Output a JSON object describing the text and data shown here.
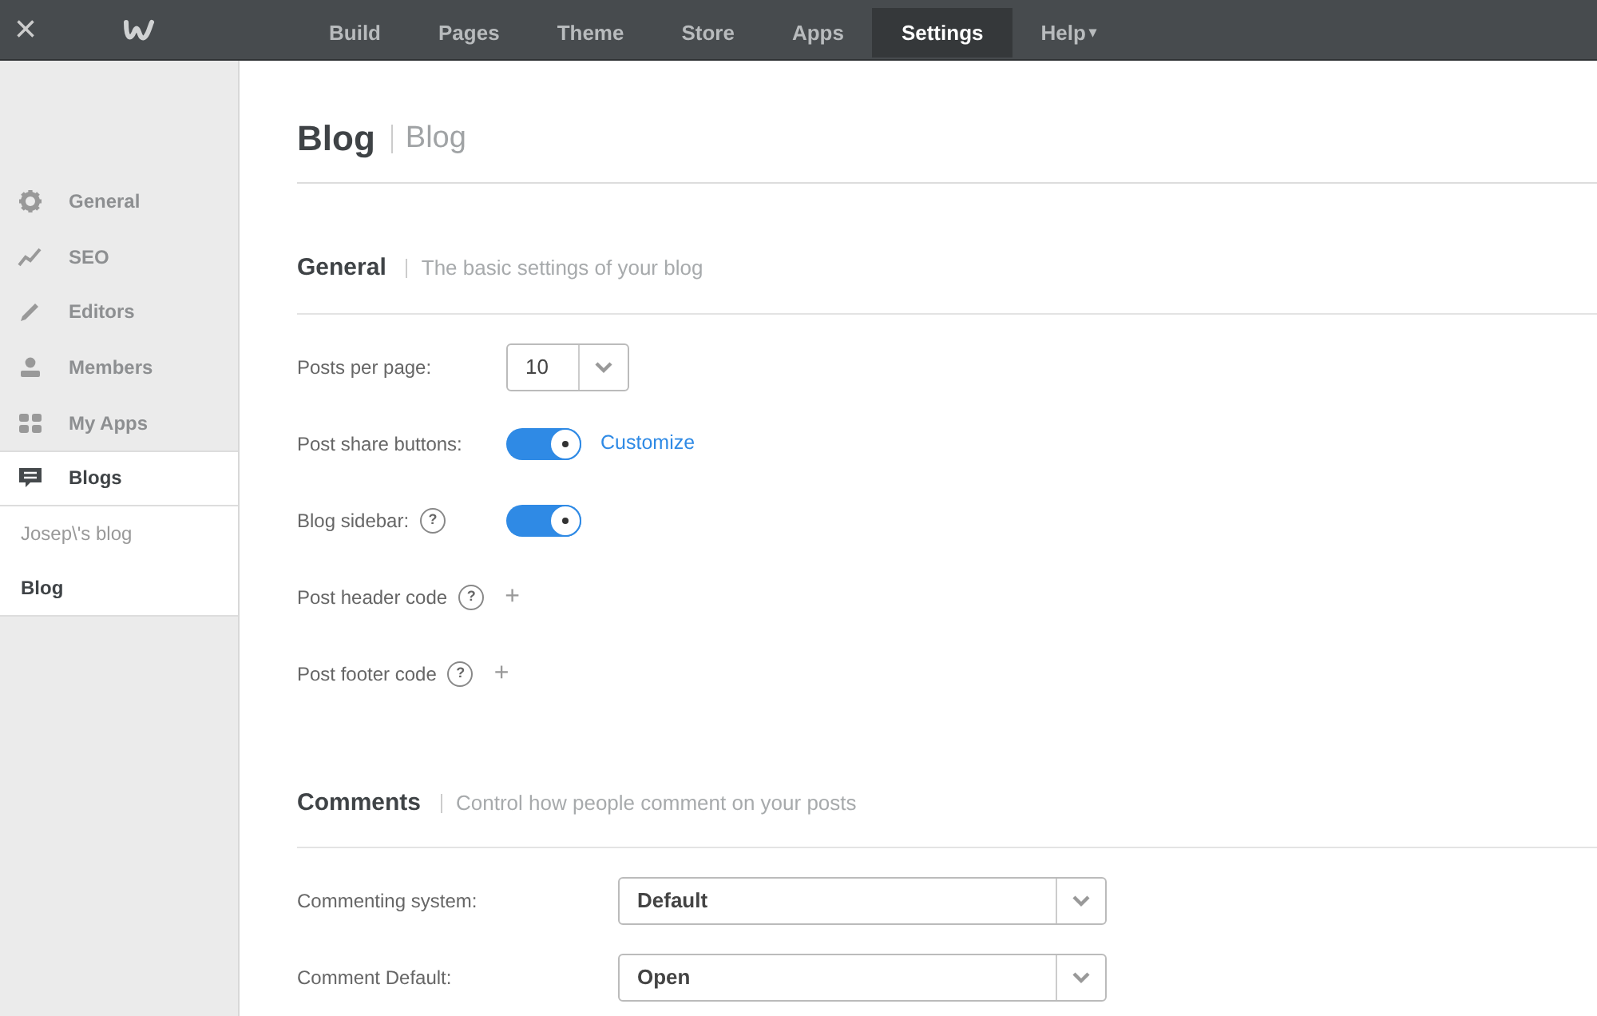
{
  "topbar": {
    "close": "×",
    "tabs": [
      {
        "label": "Build",
        "selected": false
      },
      {
        "label": "Pages",
        "selected": false
      },
      {
        "label": "Theme",
        "selected": false
      },
      {
        "label": "Store",
        "selected": false
      },
      {
        "label": "Apps",
        "selected": false
      },
      {
        "label": "Settings",
        "selected": true
      },
      {
        "label": "Help",
        "selected": false,
        "caret": "▾"
      }
    ]
  },
  "sidebar": {
    "items": [
      {
        "label": "General",
        "selected": false
      },
      {
        "label": "SEO",
        "selected": false
      },
      {
        "label": "Editors",
        "selected": false
      },
      {
        "label": "Members",
        "selected": false
      },
      {
        "label": "My Apps",
        "selected": false
      },
      {
        "label": "Blogs",
        "selected": true
      }
    ],
    "sub_items": [
      {
        "label": "Josep\\'s blog",
        "selected": false
      },
      {
        "label": "Blog",
        "selected": true
      }
    ]
  },
  "page": {
    "title": "Blog",
    "subtitle": "Blog"
  },
  "sections": [
    {
      "title": "General",
      "description": "The basic settings of your blog",
      "settings": [
        {
          "kind": "select",
          "label": "Posts per page:",
          "value": "10",
          "wide": false
        },
        {
          "kind": "toggle",
          "label": "Post share buttons:",
          "on": true,
          "link": "Customize"
        },
        {
          "kind": "toggle",
          "label": "Blog sidebar:",
          "help": "?",
          "on": true
        },
        {
          "kind": "code",
          "label": "Post header code",
          "help": "?",
          "add": "+"
        },
        {
          "kind": "code",
          "label": "Post footer code",
          "help": "?",
          "add": "+"
        }
      ]
    },
    {
      "title": "Comments",
      "description": "Control how people comment on your posts",
      "settings": [
        {
          "kind": "select",
          "label": "Commenting system:",
          "value": "Default",
          "wide": true
        },
        {
          "kind": "select",
          "label": "Comment Default:",
          "value": "Open",
          "wide": true
        }
      ]
    }
  ]
}
